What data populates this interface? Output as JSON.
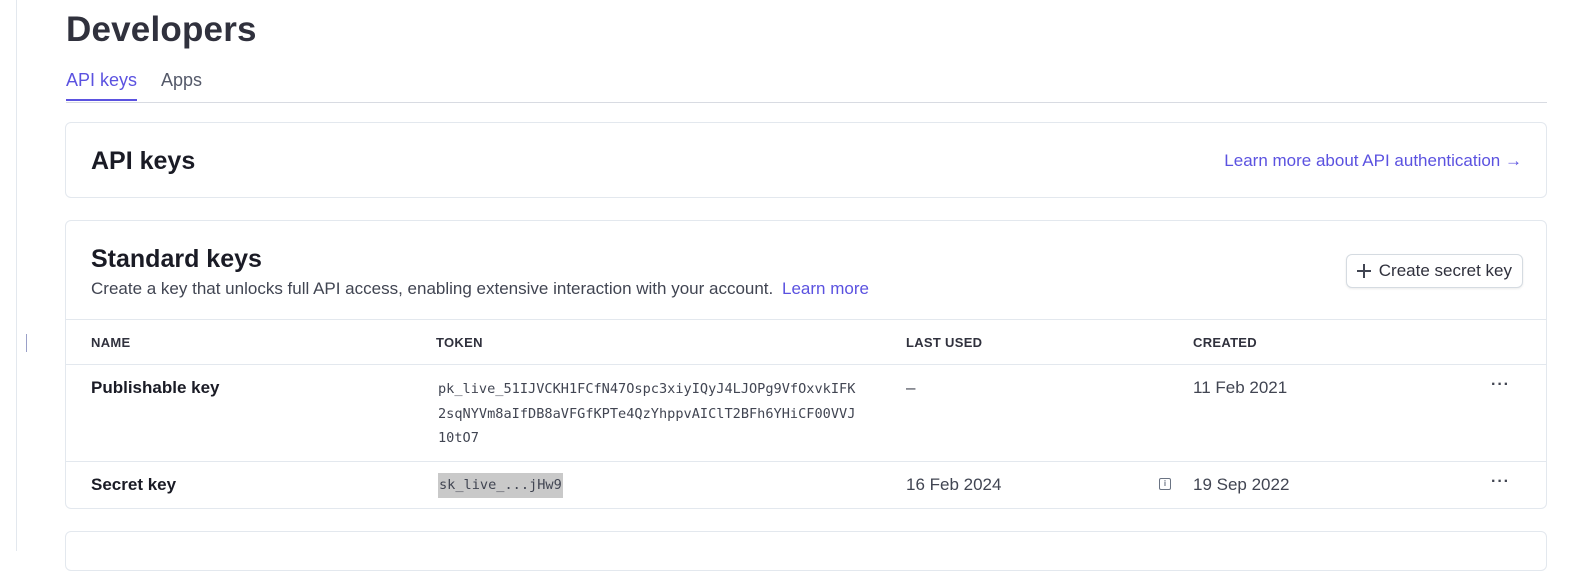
{
  "page": {
    "title": "Developers"
  },
  "tabs": [
    {
      "label": "API keys",
      "active": true
    },
    {
      "label": "Apps",
      "active": false
    }
  ],
  "api_keys_card": {
    "title": "API keys",
    "learn_link": "Learn more about API authentication →"
  },
  "standard_keys": {
    "title": "Standard keys",
    "description": "Create a key that unlocks full API access, enabling extensive interaction with your account.",
    "learn_more": "Learn more",
    "create_button": "Create secret key",
    "columns": {
      "name": "NAME",
      "token": "TOKEN",
      "last_used": "LAST USED",
      "created": "CREATED"
    },
    "rows": [
      {
        "name": "Publishable key",
        "token": "pk_live_51IJVCKH1FCfN47Ospc3xiyIQyJ4LJOPg9VfOxvkIFK2sqNYVm8aIfDB8aVFGfKPTe4QzYhppvAIClT2BFh6YHiCF00VVJ10tO7",
        "last_used": "–",
        "created": "11 Feb 2021"
      },
      {
        "name": "Secret key",
        "token": "sk_live_...jHw9",
        "last_used": "16 Feb 2024",
        "created": "19 Sep 2022"
      }
    ]
  },
  "colors": {
    "accent": "#5b52e0",
    "text": "#1a1b25",
    "border": "#e3e8ee"
  }
}
